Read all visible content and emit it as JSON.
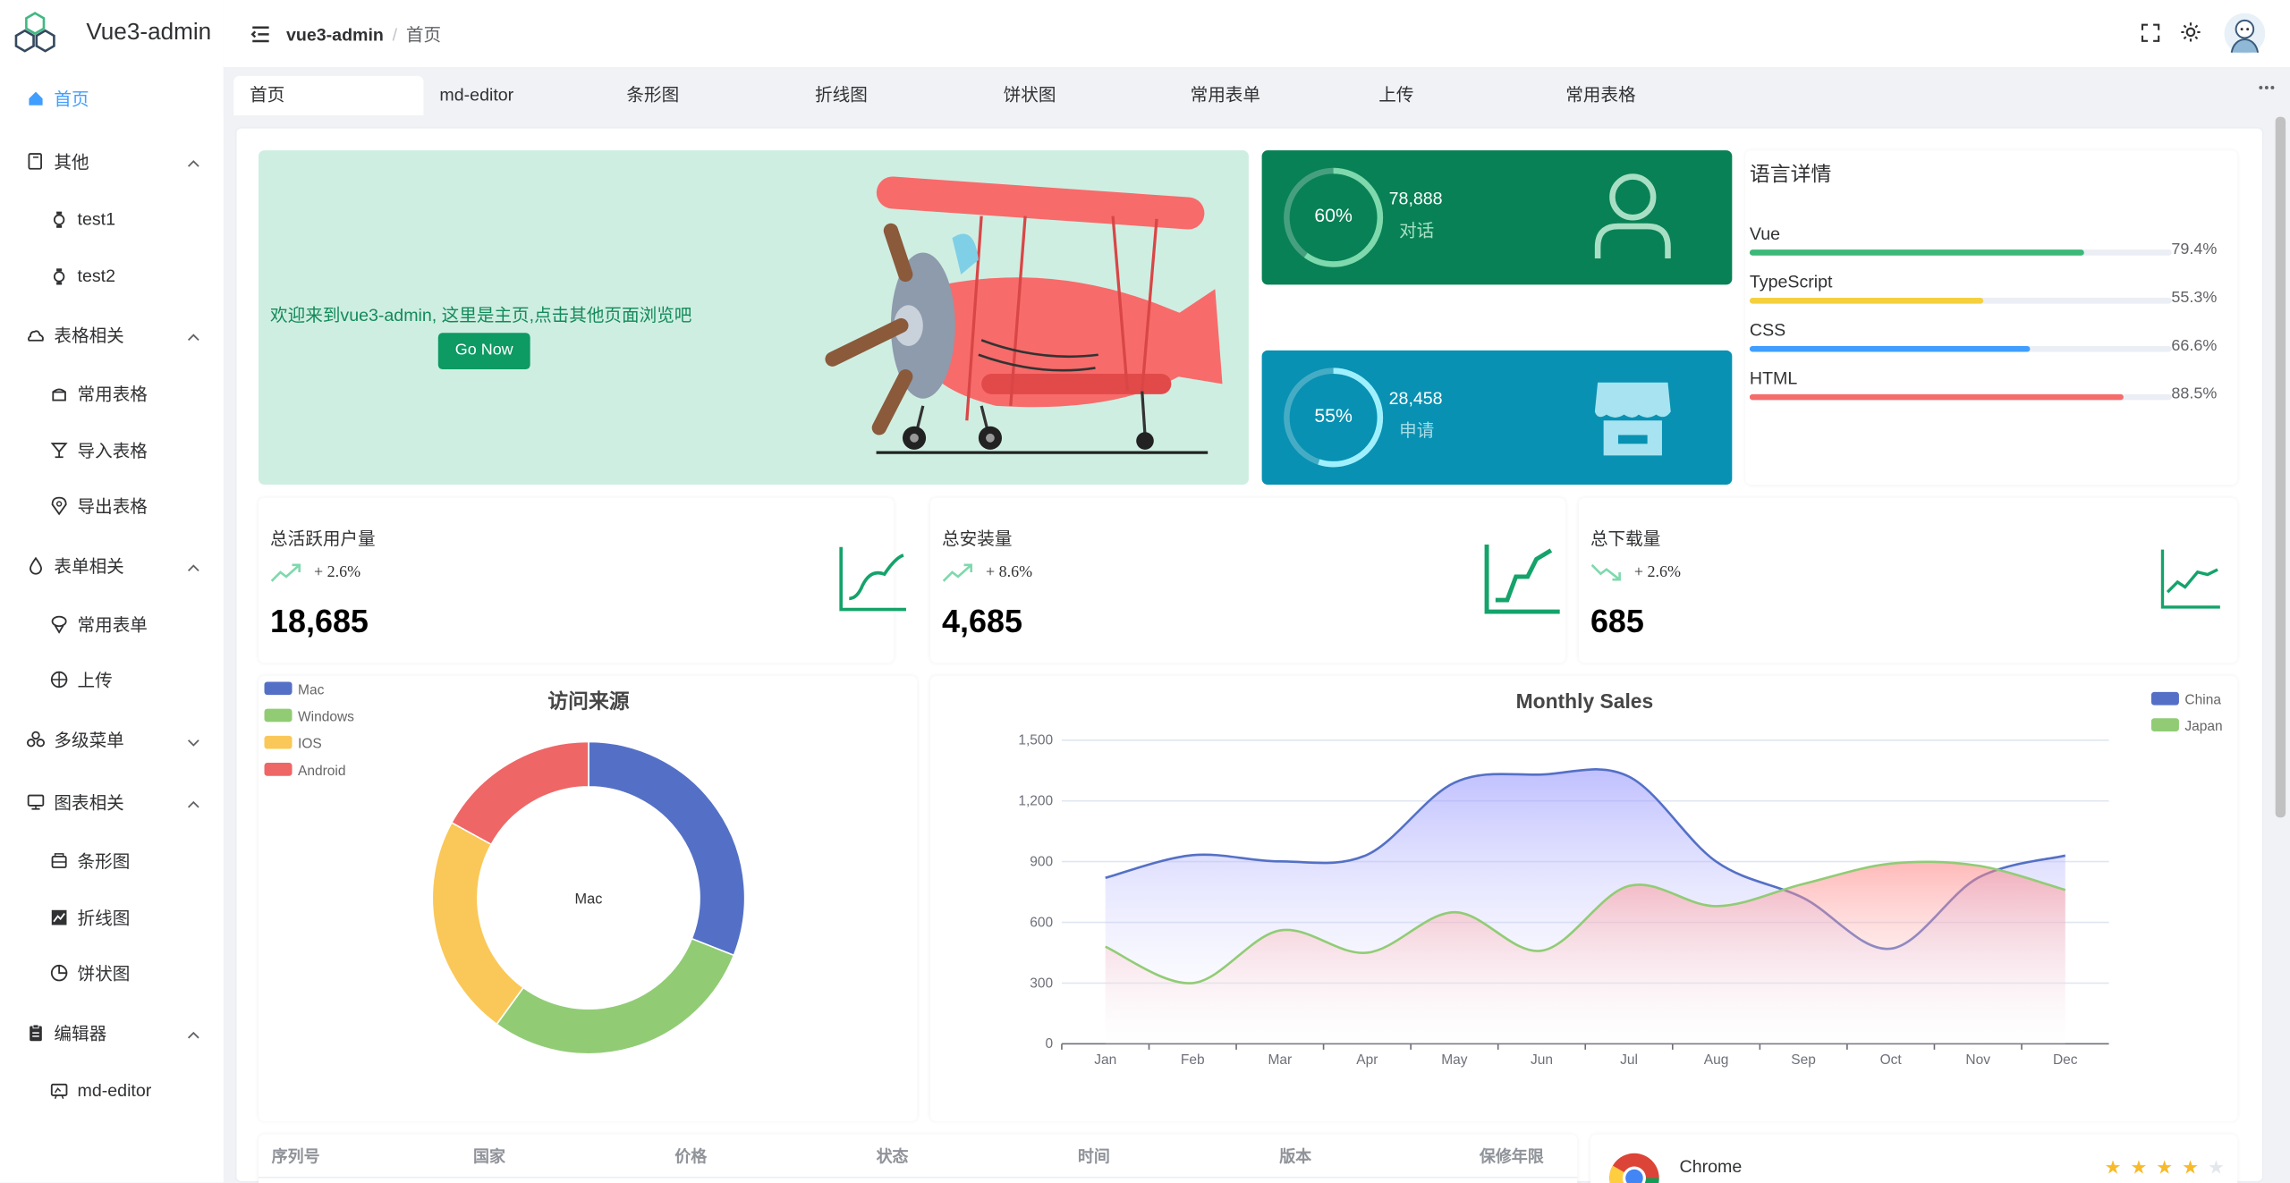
{
  "app": {
    "title": "Vue3-admin"
  },
  "breadcrumb": {
    "root": "vue3-admin",
    "sep": "/",
    "current": "首页"
  },
  "sidebar": {
    "items": [
      {
        "label": "首页",
        "icon": "home-icon",
        "active": true
      },
      {
        "label": "其他",
        "icon": "file-icon",
        "group": true
      },
      {
        "label": "test1",
        "icon": "watch-icon",
        "sub": true
      },
      {
        "label": "test2",
        "icon": "watch-icon",
        "sub": true
      },
      {
        "label": "表格相关",
        "icon": "cloud-icon",
        "group": true
      },
      {
        "label": "常用表格",
        "icon": "cake-icon",
        "sub": true
      },
      {
        "label": "导入表格",
        "icon": "cup-icon",
        "sub": true
      },
      {
        "label": "导出表格",
        "icon": "location-icon",
        "sub": true
      },
      {
        "label": "表单相关",
        "icon": "drop-icon",
        "group": true
      },
      {
        "label": "常用表单",
        "icon": "ice-cream-icon",
        "sub": true
      },
      {
        "label": "上传",
        "icon": "basketball-icon",
        "sub": true
      },
      {
        "label": "多级菜单",
        "icon": "bicycle-icon",
        "group": true,
        "collapsed": true
      },
      {
        "label": "图表相关",
        "icon": "monitor-icon",
        "group": true
      },
      {
        "label": "条形图",
        "icon": "chest-icon",
        "sub": true
      },
      {
        "label": "折线图",
        "icon": "line-chart-icon",
        "sub": true
      },
      {
        "label": "饼状图",
        "icon": "pie-chart-icon",
        "sub": true
      },
      {
        "label": "编辑器",
        "icon": "clipboard-icon",
        "group": true
      },
      {
        "label": "md-editor",
        "icon": "edit-board-icon",
        "sub": true
      }
    ]
  },
  "tabs": [
    "首页",
    "md-editor",
    "条形图",
    "折线图",
    "饼状图",
    "常用表单",
    "上传",
    "常用表格"
  ],
  "banner": {
    "text": "欢迎来到vue3-admin, 这里是主页,点击其他页面浏览吧",
    "button": "Go Now"
  },
  "stats": [
    {
      "percent": "60%",
      "value": "78,888",
      "label": "对话",
      "progress": 0.6,
      "color": "#088156",
      "icon": "user-icon"
    },
    {
      "percent": "55%",
      "value": "28,458",
      "label": "申请",
      "progress": 0.55,
      "color": "#0891b2",
      "icon": "shop-icon"
    }
  ],
  "languages": {
    "title": "语言详情",
    "items": [
      {
        "name": "Vue",
        "pct": "79.4%",
        "value": 0.794,
        "color": "#3cb878"
      },
      {
        "name": "TypeScript",
        "pct": "55.3%",
        "value": 0.553,
        "color": "#f4d03f"
      },
      {
        "name": "CSS",
        "pct": "66.6%",
        "value": 0.666,
        "color": "#409eff"
      },
      {
        "name": "HTML",
        "pct": "88.5%",
        "value": 0.885,
        "color": "#f56c6c"
      }
    ]
  },
  "kpis": [
    {
      "title": "总活跃用户量",
      "delta": "+ 2.6%",
      "value": "18,685",
      "trend": "up"
    },
    {
      "title": "总安装量",
      "delta": "+ 8.6%",
      "value": "4,685",
      "trend": "up"
    },
    {
      "title": "总下载量",
      "delta": "+ 2.6%",
      "value": "685",
      "trend": "down"
    }
  ],
  "chart_data": [
    {
      "type": "pie",
      "title": "访问来源",
      "center_label": "Mac",
      "categories": [
        "Mac",
        "Windows",
        "IOS",
        "Android"
      ],
      "values": [
        31,
        29,
        23,
        17
      ],
      "colors": [
        "#5470c6",
        "#91cc75",
        "#fac858",
        "#ee6666"
      ],
      "legend": "top-left"
    },
    {
      "type": "area",
      "title": "Monthly Sales",
      "x": [
        "Jan",
        "Feb",
        "Mar",
        "Apr",
        "May",
        "Jun",
        "Jul",
        "Aug",
        "Sep",
        "Oct",
        "Nov",
        "Dec"
      ],
      "series": [
        {
          "name": "China",
          "color": "#5470c6",
          "values": [
            820,
            932,
            901,
            934,
            1290,
            1330,
            1320,
            900,
            720,
            470,
            820,
            930
          ]
        },
        {
          "name": "Japan",
          "color": "#91cc75",
          "values": [
            480,
            300,
            560,
            450,
            650,
            460,
            780,
            680,
            790,
            890,
            880,
            760
          ]
        }
      ],
      "ylim": [
        0,
        1500
      ],
      "yticks": [
        "0",
        "300",
        "600",
        "900",
        "1,200",
        "1,500"
      ],
      "legend": "top-right",
      "grid": true
    }
  ],
  "table": {
    "headers": [
      "序列号",
      "国家",
      "价格",
      "状态",
      "时间",
      "版本",
      "保修年限"
    ]
  },
  "browser_card": {
    "name": "Chrome",
    "stars": 4
  }
}
